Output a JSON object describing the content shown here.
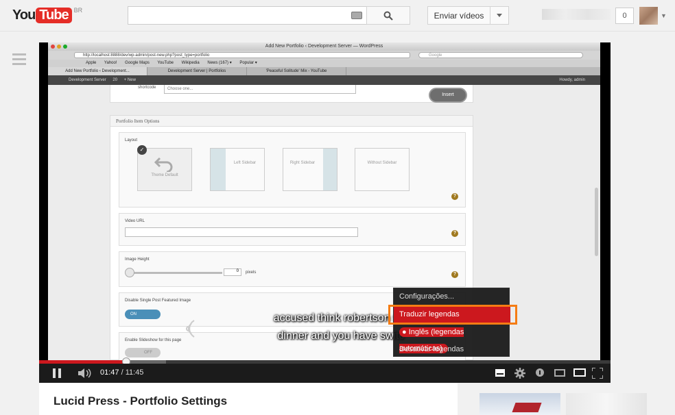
{
  "header": {
    "logo_you": "You",
    "logo_tube": "Tube",
    "logo_region": "BR",
    "search_placeholder": "",
    "upload_label": "Enviar vídeos",
    "notifications_count": "0"
  },
  "video": {
    "browser_title": "Add New Portfolio ‹ Development Server — WordPress",
    "browser_url": "http://localhost:8888/dev/wp-admin/post-new.php?post_type=portfolio",
    "browser_search_placeholder": "Google",
    "bookmarks": [
      "Apple",
      "Yahoo!",
      "Google Maps",
      "YouTube",
      "Wikipedia",
      "News (167) ▾",
      "Popular ▾"
    ],
    "tabs": [
      "Add New Portfolio ‹ Development...",
      "Development Server | Portfolios",
      "'Peaceful Solitude' Mix - YouTube"
    ],
    "wp_bar": {
      "site": "Development Server",
      "comments": "20",
      "new": "+ New",
      "howdy": "Howdy, admin"
    },
    "shortcode_label": "shortcode",
    "select_placeholder": "Choose one...",
    "insert_label": "Insert",
    "panel_title": "Portfolio Item Options",
    "layout": {
      "label": "Layout",
      "options": [
        "Theme Default",
        "Left Sidebar",
        "Right Sidebar",
        "Without Sidebar"
      ]
    },
    "video_url_label": "Video URL",
    "image_height_label": "Image Height",
    "image_height_value": "0",
    "image_height_unit": "pixels",
    "disable_featured_label": "Disable Single Post Featured Image",
    "toggle_on": "ON",
    "enable_slideshow_label": "Enable Slideshow for this page",
    "toggle_off": "OFF",
    "captions": [
      "accused think robertson ser",
      "dinner and you have switc"
    ]
  },
  "cc_menu": {
    "settings": "Configurações...",
    "translate": "Traduzir legendas",
    "english": "Inglês (legendas automáticas)",
    "disable": "Desativar legendas"
  },
  "player": {
    "elapsed": "01:47",
    "separator": " / ",
    "duration": "11:45",
    "progress_fraction": 0.152,
    "buffered_fraction": 0.222
  },
  "page": {
    "video_title": "Lucid Press - Portfolio Settings"
  },
  "colors": {
    "youtube_red": "#e52d27",
    "player_red": "#cc181e",
    "highlight_orange": "#f57c14"
  }
}
